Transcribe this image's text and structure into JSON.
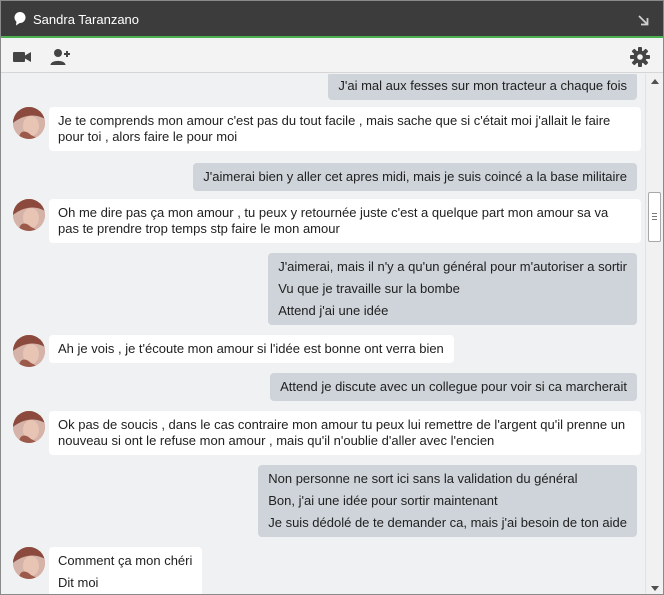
{
  "window": {
    "contact_name": "Sandra Taranzano",
    "accent_color": "#4caf50",
    "titlebar_color": "#3c3c3c",
    "icons": {
      "status": "chat-bubble-icon",
      "popout": "arrow-down-right-icon",
      "video": "video-camera-icon",
      "add_person": "add-person-icon",
      "settings": "gear-icon"
    }
  },
  "messages": [
    {
      "from": "me",
      "lines": [
        "J'ai mal aux fesses sur mon tracteur a chaque fois"
      ]
    },
    {
      "from": "contact",
      "lines": [
        "Je te comprends mon amour c'est pas du tout facile , mais sache que si c'était moi j'allait le faire pour toi , alors faire le pour moi"
      ]
    },
    {
      "from": "me",
      "lines": [
        "J'aimerai bien y aller cet apres midi, mais je suis coincé a la base militaire"
      ]
    },
    {
      "from": "contact",
      "lines": [
        "Oh me dire pas ça mon amour , tu peux y retournée juste c'est a quelque part mon amour sa va pas te prendre trop temps stp faire le mon amour"
      ]
    },
    {
      "from": "me",
      "lines": [
        "J'aimerai, mais il n'y a qu'un général pour m'autoriser a sortir",
        "Vu que je travaille sur la bombe",
        "Attend j'ai une idée"
      ]
    },
    {
      "from": "contact",
      "lines": [
        "Ah je vois , je t'écoute mon amour si l'idée est bonne ont verra bien"
      ]
    },
    {
      "from": "me",
      "lines": [
        "Attend je discute avec un collegue pour voir si ca marcherait"
      ]
    },
    {
      "from": "contact",
      "lines": [
        "Ok pas de soucis , dans le cas contraire mon amour tu peux lui remettre de l'argent qu'il prenne un nouveau si ont le refuse mon amour , mais qu'il n'oublie d'aller avec l'encien"
      ]
    },
    {
      "from": "me",
      "lines": [
        "Non personne ne sort ici sans la validation du général",
        "Bon, j'ai une idée pour sortir maintenant",
        "Je suis dédolé de te demander ca, mais j'ai besoin de ton aide"
      ]
    },
    {
      "from": "contact",
      "lines": [
        "Comment ça mon chéri",
        "Dit moi"
      ]
    }
  ]
}
